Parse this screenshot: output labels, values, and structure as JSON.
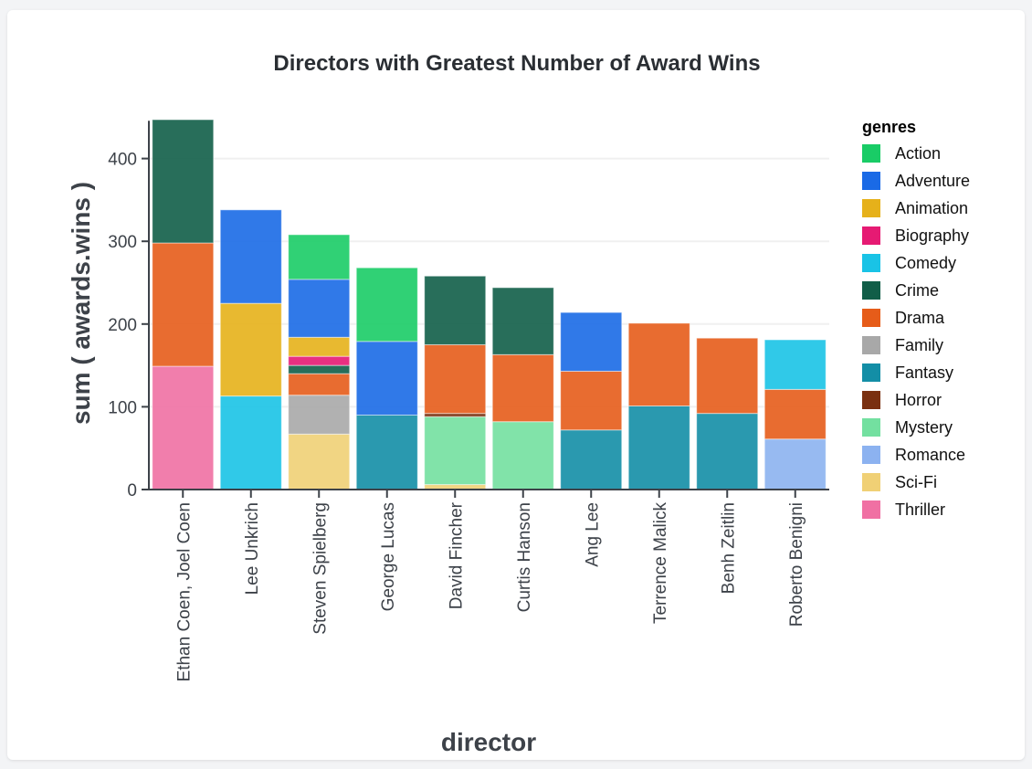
{
  "chart_data": {
    "type": "bar",
    "stacked": true,
    "title": "Directors with Greatest Number of Award Wins",
    "xlabel": "director",
    "ylabel": "sum ( awards.wins )",
    "ylim": [
      0,
      450
    ],
    "yticks": [
      0,
      100,
      200,
      300,
      400
    ],
    "grid": true,
    "legend": {
      "title": "genres",
      "placement": "right"
    },
    "categories": [
      "Ethan Coen, Joel Coen",
      "Lee Unkrich",
      "Steven Spielberg",
      "George Lucas",
      "David Fincher",
      "Curtis Hanson",
      "Ang Lee",
      "Terrence Malick",
      "Benh Zeitlin",
      "Roberto Benigni"
    ],
    "genres": [
      {
        "name": "Action",
        "color": "#19cc66"
      },
      {
        "name": "Adventure",
        "color": "#1a6ae6"
      },
      {
        "name": "Animation",
        "color": "#e6b11a"
      },
      {
        "name": "Biography",
        "color": "#e61a73"
      },
      {
        "name": "Comedy",
        "color": "#19c3e6"
      },
      {
        "name": "Crime",
        "color": "#115e48"
      },
      {
        "name": "Drama",
        "color": "#e65c19"
      },
      {
        "name": "Family",
        "color": "#a8a8a8"
      },
      {
        "name": "Fantasy",
        "color": "#138ea6"
      },
      {
        "name": "Horror",
        "color": "#7a3010"
      },
      {
        "name": "Mystery",
        "color": "#73e0a0"
      },
      {
        "name": "Romance",
        "color": "#8cb2f0"
      },
      {
        "name": "Sci-Fi",
        "color": "#f0d075"
      },
      {
        "name": "Thriller",
        "color": "#f070a3"
      }
    ],
    "stacks": [
      {
        "director": "Ethan Coen, Joel Coen",
        "segments": [
          [
            "Thriller",
            149
          ],
          [
            "Drama",
            149
          ],
          [
            "Crime",
            149
          ]
        ]
      },
      {
        "director": "Lee Unkrich",
        "segments": [
          [
            "Comedy",
            113
          ],
          [
            "Animation",
            112
          ],
          [
            "Adventure",
            113
          ]
        ]
      },
      {
        "director": "Steven Spielberg",
        "segments": [
          [
            "Sci-Fi",
            67
          ],
          [
            "Family",
            47
          ],
          [
            "Drama",
            26
          ],
          [
            "Crime",
            10
          ],
          [
            "Biography",
            11
          ],
          [
            "Animation",
            23
          ],
          [
            "Adventure",
            70
          ],
          [
            "Action",
            54
          ]
        ]
      },
      {
        "director": "George Lucas",
        "segments": [
          [
            "Fantasy",
            90
          ],
          [
            "Adventure",
            89
          ],
          [
            "Action",
            89
          ]
        ]
      },
      {
        "director": "David Fincher",
        "segments": [
          [
            "Sci-Fi",
            6
          ],
          [
            "Mystery",
            82
          ],
          [
            "Horror",
            4
          ],
          [
            "Drama",
            83
          ],
          [
            "Crime",
            83
          ]
        ]
      },
      {
        "director": "Curtis Hanson",
        "segments": [
          [
            "Mystery",
            82
          ],
          [
            "Drama",
            81
          ],
          [
            "Crime",
            81
          ]
        ]
      },
      {
        "director": "Ang Lee",
        "segments": [
          [
            "Fantasy",
            72
          ],
          [
            "Drama",
            71
          ],
          [
            "Adventure",
            71
          ]
        ]
      },
      {
        "director": "Terrence Malick",
        "segments": [
          [
            "Fantasy",
            101
          ],
          [
            "Drama",
            100
          ]
        ]
      },
      {
        "director": "Benh Zeitlin",
        "segments": [
          [
            "Fantasy",
            92
          ],
          [
            "Drama",
            91
          ]
        ]
      },
      {
        "director": "Roberto Benigni",
        "segments": [
          [
            "Romance",
            61
          ],
          [
            "Drama",
            60
          ],
          [
            "Comedy",
            60
          ]
        ]
      }
    ]
  }
}
